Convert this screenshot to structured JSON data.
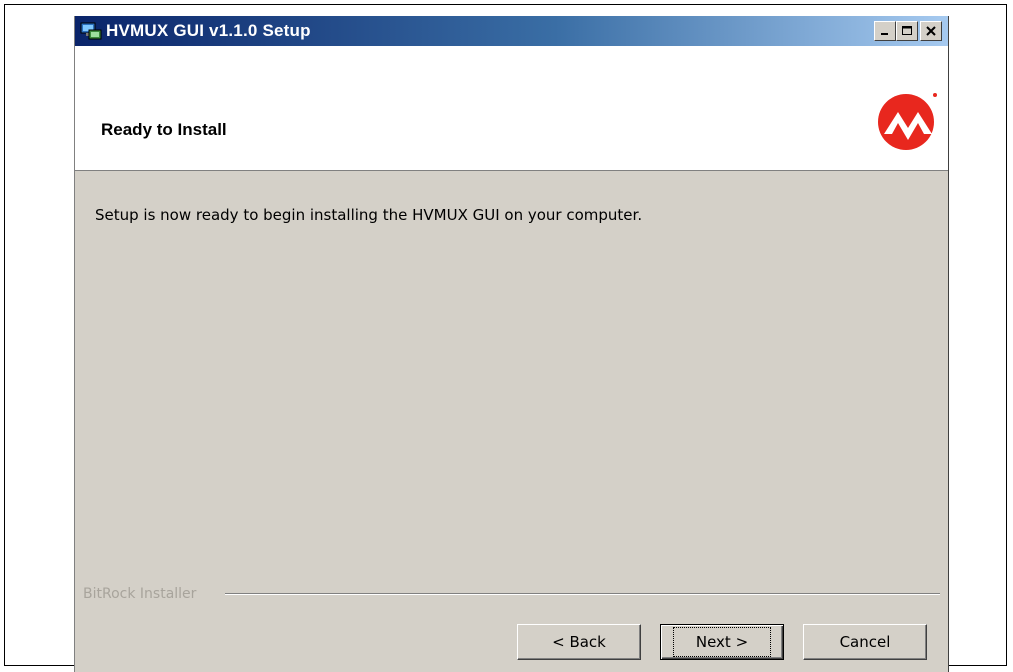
{
  "window": {
    "title": "HVMUX GUI v1.1.0 Setup",
    "controls": [
      "minimize-icon",
      "maximize-icon",
      "close-icon"
    ]
  },
  "header": {
    "title": "Ready to Install",
    "logo": "microchip-logo"
  },
  "body": {
    "message": "Setup is now ready to begin installing the HVMUX GUI on your computer."
  },
  "footer": {
    "installer_label": "BitRock Installer",
    "back_label": "< Back",
    "next_label": "Next >",
    "cancel_label": "Cancel"
  },
  "colors": {
    "titlebar_start": "#0a246a",
    "titlebar_end": "#a6caf0",
    "dialog_bg": "#d4d0c8",
    "logo_red": "#e8271e"
  }
}
